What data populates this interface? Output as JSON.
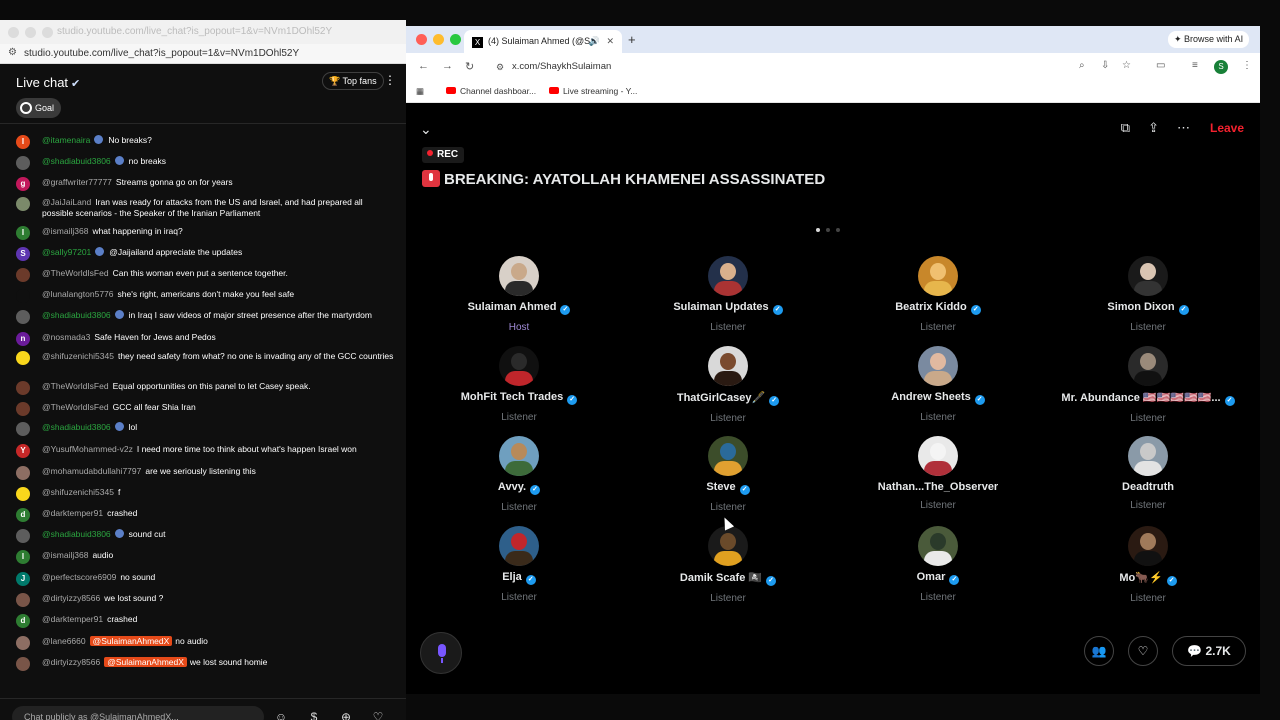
{
  "chat_window": {
    "title": "studio.youtube.com/live_chat?is_popout=1&v=NVm1DOhl52Y",
    "url": "studio.youtube.com/live_chat?is_popout=1&v=NVm1DOhl52Y",
    "header": {
      "title": "Live chat",
      "top_fans_label": "Top fans",
      "goal_label": "Goal"
    },
    "messages": [
      {
        "author": "@itamenaira",
        "text": "No breaks?",
        "avatar": "I",
        "color": "#e64a19",
        "mod": true
      },
      {
        "author": "@shadiabuid3806",
        "text": "no breaks",
        "avatar": "",
        "color": "#5d5d5d",
        "mod": true
      },
      {
        "author": "@graffwriter77777",
        "text": "Streams gonna go on for years",
        "avatar": "g",
        "color": "#c2185b",
        "mod": false
      },
      {
        "author": "@JaiJaiLand",
        "text": "Iran was ready for attacks from the US and Israel, and had prepared all possible scenarios - the Speaker of the Iranian Parliament",
        "avatar": "",
        "color": "#7b8a6a",
        "mod": false
      },
      {
        "author": "@ismailj368",
        "text": "what happening in iraq?",
        "avatar": "I",
        "color": "#2e7d32",
        "mod": false
      },
      {
        "author": "@sally97201",
        "text": "@Jaijailand appreciate the updates",
        "avatar": "S",
        "color": "#5e35b1",
        "mod": true
      },
      {
        "author": "@TheWorldIsFed",
        "text": "Can this woman even put a sentence together.",
        "avatar": "",
        "color": "#6b3a2a",
        "mod": false
      },
      {
        "author": "@lunalangton5776",
        "text": "she's right, americans don't make you feel safe",
        "avatar": "",
        "color": "#0f0f0f",
        "mod": false
      },
      {
        "author": "@shadiabuid3806",
        "text": "in Iraq I saw videos of major street presence after the martyrdom",
        "avatar": "",
        "color": "#5d5d5d",
        "mod": true
      },
      {
        "author": "@nosmada3",
        "text": "Safe Haven for Jews and Pedos",
        "avatar": "n",
        "color": "#6a1b9a",
        "mod": false
      },
      {
        "author": "@shifuzenichi5345",
        "text": "they need safety from what? no one is invading any of the GCC countries",
        "avatar": "",
        "color": "#f9d71c",
        "mod": false
      },
      {
        "author": "@TheWorldIsFed",
        "text": "Equal opportunities on this panel to let Casey speak.",
        "avatar": "",
        "color": "#6b3a2a",
        "mod": false
      },
      {
        "author": "@TheWorldIsFed",
        "text": "GCC all fear Shia Iran",
        "avatar": "",
        "color": "#6b3a2a",
        "mod": false
      },
      {
        "author": "@shadiabuid3806",
        "text": "lol",
        "avatar": "",
        "color": "#5d5d5d",
        "mod": true
      },
      {
        "author": "@YusufMohammed-v2z",
        "text": "I need more time too think about what's happen Israel won",
        "avatar": "Y",
        "color": "#c62828",
        "mod": false
      },
      {
        "author": "@mohamudabdullahi7797",
        "text": "are we seriously listening this",
        "avatar": "",
        "color": "#8d6e63",
        "mod": false
      },
      {
        "author": "@shifuzenichi5345",
        "text": "f",
        "avatar": "",
        "color": "#f9d71c",
        "mod": false
      },
      {
        "author": "@darktemper91",
        "text": "crashed",
        "avatar": "d",
        "color": "#2e7d32",
        "mod": false
      },
      {
        "author": "@shadiabuid3806",
        "text": "sound cut",
        "avatar": "",
        "color": "#5d5d5d",
        "mod": true
      },
      {
        "author": "@ismailj368",
        "text": "audio",
        "avatar": "I",
        "color": "#2e7d32",
        "mod": false
      },
      {
        "author": "@perfectscore6909",
        "text": "no sound",
        "avatar": "J",
        "color": "#00796b",
        "mod": false
      },
      {
        "author": "@dirtyizzy8566",
        "text": "we lost sound ?",
        "avatar": "",
        "color": "#795548",
        "mod": false
      },
      {
        "author": "@darktemper91",
        "text": "crashed",
        "avatar": "d",
        "color": "#2e7d32",
        "mod": false
      },
      {
        "author": "@lane6660",
        "mention": "@SulaimanAhmedX",
        "text": "no audio",
        "avatar": "",
        "color": "#8d6e63",
        "mod": false
      },
      {
        "author": "@dirtyizzy8566",
        "mention": "@SulaimanAhmedX",
        "text": "we lost sound homie",
        "avatar": "",
        "color": "#795548",
        "mod": false
      }
    ],
    "input_placeholder": "Chat publicly as @SulaimanAhmedX..."
  },
  "browser": {
    "tab_title": "(4) Sulaiman Ahmed (@S",
    "url": "x.com/ShaykhSulaiman",
    "browse_ai_label": "Browse with AI",
    "profile_initial": "S",
    "bookmarks": [
      "Channel dashboar...",
      "Live streaming - Y..."
    ]
  },
  "space": {
    "leave_label": "Leave",
    "rec_label": "REC",
    "title": "BREAKING: AYATOLLAH KHAMENEI ASSASSINATED",
    "participants": [
      {
        "name": "Sulaiman Ahmed",
        "role": "Host",
        "host": true,
        "verified": true,
        "colors": [
          "#d8d0c8",
          "#2a2a2a",
          "#c9a98a"
        ]
      },
      {
        "name": "Sulaiman Updates",
        "role": "Listener",
        "verified": true,
        "colors": [
          "#23304a",
          "#a33",
          "#d9b08c"
        ]
      },
      {
        "name": "Beatrix Kiddo",
        "role": "Listener",
        "verified": true,
        "colors": [
          "#c8872a",
          "#e7b64c",
          "#f0c070"
        ]
      },
      {
        "name": "Simon Dixon",
        "role": "Listener",
        "verified": true,
        "colors": [
          "#1a1a1a",
          "#333",
          "#d9c4b2"
        ]
      },
      {
        "name": "MohFit Tech Trades",
        "role": "Listener",
        "verified": true,
        "colors": [
          "#101010",
          "#c0262b",
          "#2a2a2a"
        ]
      },
      {
        "name": "ThatGirlCasey🖋️",
        "role": "Listener",
        "verified": true,
        "colors": [
          "#d9d9d9",
          "#2a1a12",
          "#7a4a2e"
        ]
      },
      {
        "name": "Andrew Sheets",
        "role": "Listener",
        "verified": true,
        "colors": [
          "#7a8aa0",
          "#c9a98a",
          "#e1b9a0"
        ]
      },
      {
        "name": "Mr. Abundance 🇺🇸🇺🇸🇺🇸🇺🇸🇺🇸...",
        "role": "Listener",
        "verified": true,
        "colors": [
          "#2a2a2a",
          "#111",
          "#9a8a7a"
        ]
      },
      {
        "name": "Avvy.",
        "role": "Listener",
        "verified": true,
        "colors": [
          "#6f9fbf",
          "#3d6b3a",
          "#b78a5a"
        ]
      },
      {
        "name": "Steve",
        "role": "Listener",
        "verified": true,
        "colors": [
          "#3c4d2a",
          "#e0a030",
          "#2a6a9a"
        ]
      },
      {
        "name": "Nathan...The_Observer",
        "role": "Listener",
        "verified": false,
        "colors": [
          "#e9e9e9",
          "#b0303a",
          "#f4f4f4"
        ]
      },
      {
        "name": "Deadtruth",
        "role": "Listener",
        "verified": false,
        "colors": [
          "#8a9aa8",
          "#e3e3e3",
          "#c9c9c9"
        ]
      },
      {
        "name": "Elja",
        "role": "Listener",
        "verified": true,
        "colors": [
          "#2e5f8a",
          "#3a2a1a",
          "#c0262b"
        ]
      },
      {
        "name": "Damik Scafe 🏴‍☠️",
        "role": "Listener",
        "verified": true,
        "colors": [
          "#1a1a1a",
          "#e0a020",
          "#6a4a2a"
        ]
      },
      {
        "name": "Omar",
        "role": "Listener",
        "verified": true,
        "colors": [
          "#4a5a3a",
          "#e9e9e9",
          "#2a3a2a"
        ]
      },
      {
        "name": "Mo🐂⚡",
        "role": "Listener",
        "verified": true,
        "colors": [
          "#2a1a12",
          "#111",
          "#a07a5a"
        ]
      }
    ],
    "comments_count": "2.7K"
  }
}
